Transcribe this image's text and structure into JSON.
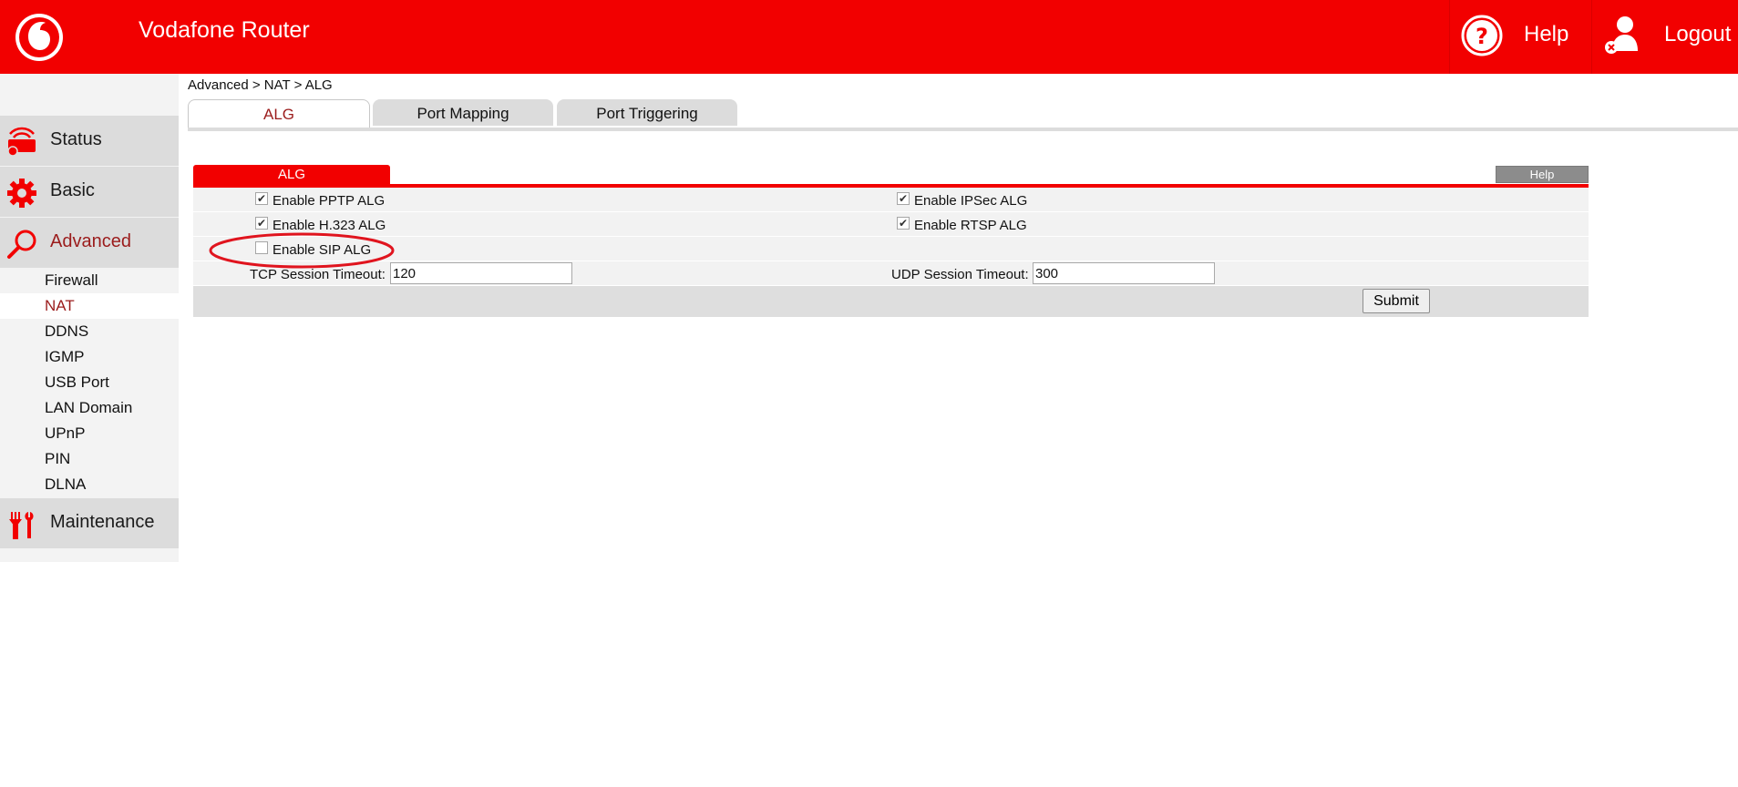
{
  "header": {
    "app_title": "Vodafone Router",
    "help_label": "Help",
    "logout_label": "Logout",
    "brand_color": "#f20000"
  },
  "sidebar": {
    "sections": [
      {
        "label": "Status",
        "icon": "wifi-router-icon"
      },
      {
        "label": "Basic",
        "icon": "gear-icon"
      },
      {
        "label": "Advanced",
        "icon": "magnifier-icon",
        "active": true
      }
    ],
    "advanced_items": [
      {
        "label": "Firewall"
      },
      {
        "label": "NAT",
        "selected": true
      },
      {
        "label": "DDNS"
      },
      {
        "label": "IGMP"
      },
      {
        "label": "USB Port"
      },
      {
        "label": "LAN Domain"
      },
      {
        "label": "UPnP"
      },
      {
        "label": "PIN"
      },
      {
        "label": "DLNA"
      }
    ],
    "maintenance": {
      "label": "Maintenance",
      "icon": "tools-icon"
    }
  },
  "breadcrumb": "Advanced > NAT > ALG",
  "tabs": [
    {
      "label": "ALG",
      "active": true
    },
    {
      "label": "Port Mapping"
    },
    {
      "label": "Port Triggering"
    }
  ],
  "panel": {
    "title": "ALG",
    "help_label": "Help",
    "options": {
      "pptp": {
        "label": "Enable PPTP ALG",
        "checked": true
      },
      "ipsec": {
        "label": "Enable IPSec ALG",
        "checked": true
      },
      "h323": {
        "label": "Enable H.323 ALG",
        "checked": true
      },
      "rtsp": {
        "label": "Enable RTSP ALG",
        "checked": true
      },
      "sip": {
        "label": "Enable SIP ALG",
        "checked": false
      }
    },
    "tcp_timeout": {
      "label": "TCP Session Timeout:",
      "value": "120"
    },
    "udp_timeout": {
      "label": "UDP Session Timeout:",
      "value": "300"
    },
    "submit_label": "Submit"
  },
  "annotation_color": "#e0141e"
}
